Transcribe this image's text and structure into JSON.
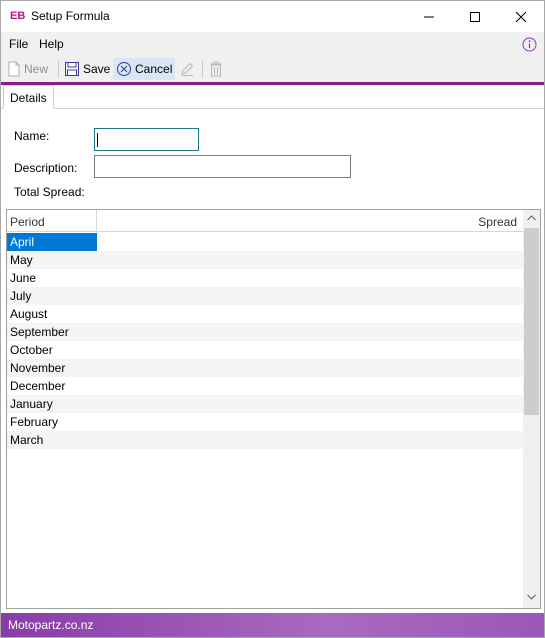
{
  "window": {
    "logo": "EB",
    "title": "Setup Formula"
  },
  "menu": {
    "file": "File",
    "help": "Help"
  },
  "toolbar": {
    "new_label": "New",
    "save_label": "Save",
    "cancel_label": "Cancel"
  },
  "tabs": [
    {
      "label": "Details"
    }
  ],
  "form": {
    "name_label": "Name:",
    "name_value": "",
    "description_label": "Description:",
    "description_value": "",
    "total_spread_label": "Total Spread:"
  },
  "grid": {
    "columns": [
      "Period",
      "Spread"
    ],
    "rows": [
      {
        "period": "April",
        "spread": ""
      },
      {
        "period": "May",
        "spread": ""
      },
      {
        "period": "June",
        "spread": ""
      },
      {
        "period": "July",
        "spread": ""
      },
      {
        "period": "August",
        "spread": ""
      },
      {
        "period": "September",
        "spread": ""
      },
      {
        "period": "October",
        "spread": ""
      },
      {
        "period": "November",
        "spread": ""
      },
      {
        "period": "December",
        "spread": ""
      },
      {
        "period": "January",
        "spread": ""
      },
      {
        "period": "February",
        "spread": ""
      },
      {
        "period": "March",
        "spread": ""
      }
    ],
    "selected_row": 0
  },
  "status": {
    "text": "Motopartz.co.nz"
  },
  "colors": {
    "accent": "#8a1c8a",
    "logo": "#b5177f",
    "selection": "#0078d7",
    "statusbar": "#9a58b8"
  }
}
